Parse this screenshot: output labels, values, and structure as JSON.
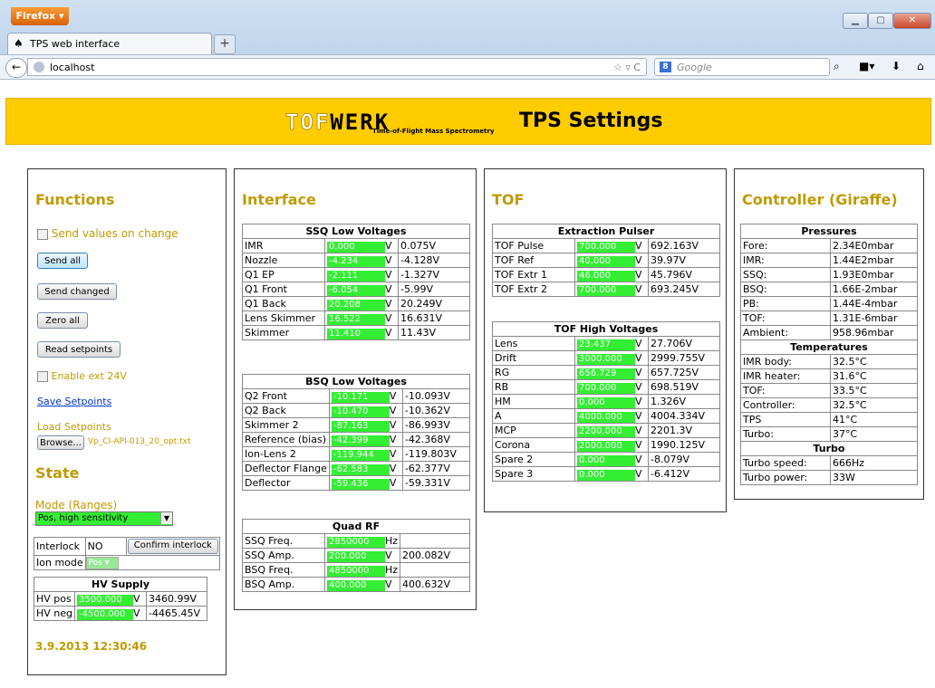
{
  "browser": {
    "app_button": "Firefox",
    "tab_title": "TPS web interface",
    "url": "localhost",
    "search_placeholder": "Google",
    "search_engine_badge": "8"
  },
  "banner": {
    "logo_light": "TOF",
    "logo_dark": "WERK",
    "logo_sub": "Time-of-Flight Mass Spectrometry",
    "title": "TPS Settings"
  },
  "functions": {
    "heading": "Functions",
    "send_on_change": "Send values on change",
    "send_all": "Send all",
    "send_changed": "Send changed",
    "zero_all": "Zero all",
    "read_setpoints": "Read setpoints",
    "enable_24v": "Enable ext 24V",
    "save_setpoints": "Save Setpoints",
    "load_setpoints": "Load Setpoints",
    "browse": "Browse...",
    "file_name": "Vp_CI-API-013_20_opt.txt"
  },
  "state": {
    "heading": "State",
    "mode_label": "Mode (Ranges)",
    "mode_value": "Pos, high sensitivity",
    "interlock_label": "Interlock",
    "interlock_value": "NO",
    "confirm_interlock": "Confirm interlock",
    "ion_mode_label": "Ion mode",
    "ion_mode_value": "Pos",
    "hv_title": "HV Supply",
    "hv_rows": [
      {
        "label": "HV pos",
        "set": "3500.000",
        "unit": "V",
        "read": "3460.99V"
      },
      {
        "label": "HV neg",
        "set": "-4500.000",
        "unit": "V",
        "read": "-4465.45V"
      }
    ],
    "timestamp": "3.9.2013 12:30:46"
  },
  "interface": {
    "heading": "Interface",
    "ssq": {
      "title": "SSQ Low Voltages",
      "rows": [
        {
          "label": "IMR",
          "set": "0.000",
          "unit": "V",
          "read": "0.075V"
        },
        {
          "label": "Nozzle",
          "set": "-4.234",
          "unit": "V",
          "read": "-4.128V"
        },
        {
          "label": "Q1 EP",
          "set": "-2.111",
          "unit": "V",
          "read": "-1.327V"
        },
        {
          "label": "Q1 Front",
          "set": "-6.054",
          "unit": "V",
          "read": "-5.99V"
        },
        {
          "label": "Q1 Back",
          "set": "20.208",
          "unit": "V",
          "read": "20.249V"
        },
        {
          "label": "Lens Skimmer",
          "set": "16.522",
          "unit": "V",
          "read": "16.631V"
        },
        {
          "label": "Skimmer",
          "set": "11.410",
          "unit": "V",
          "read": "11.43V"
        }
      ]
    },
    "bsq": {
      "title": "BSQ Low Voltages",
      "rows": [
        {
          "label": "Q2 Front",
          "set": "-10.171",
          "unit": "V",
          "read": "-10.093V"
        },
        {
          "label": "Q2 Back",
          "set": "-10.470",
          "unit": "V",
          "read": "-10.362V"
        },
        {
          "label": "Skimmer 2",
          "set": "-87.163",
          "unit": "V",
          "read": "-86.993V"
        },
        {
          "label": "Reference (bias)",
          "set": "-42.399",
          "unit": "V",
          "read": "-42.368V"
        },
        {
          "label": "Ion-Lens 2",
          "set": "-119.944",
          "unit": "V",
          "read": "-119.803V"
        },
        {
          "label": "Deflector Flange",
          "set": "-62.583",
          "unit": "V",
          "read": "-62.377V"
        },
        {
          "label": "Deflector",
          "set": "-59.436",
          "unit": "V",
          "read": "-59.331V"
        }
      ]
    },
    "quad": {
      "title": "Quad RF",
      "rows": [
        {
          "label": "SSQ Freq.",
          "set": "2850000",
          "unit": "Hz",
          "read": ""
        },
        {
          "label": "SSQ Amp.",
          "set": "200.000",
          "unit": "V",
          "read": "200.082V"
        },
        {
          "label": "BSQ Freq.",
          "set": "4850000",
          "unit": "Hz",
          "read": ""
        },
        {
          "label": "BSQ Amp.",
          "set": "400.000",
          "unit": "V",
          "read": "400.632V"
        }
      ]
    }
  },
  "tof": {
    "heading": "TOF",
    "extraction": {
      "title": "Extraction Pulser",
      "rows": [
        {
          "label": "TOF Pulse",
          "set": "700.000",
          "unit": "V",
          "read": "692.163V"
        },
        {
          "label": "TOF Ref",
          "set": "40.000",
          "unit": "V",
          "read": "39.97V"
        },
        {
          "label": "TOF Extr 1",
          "set": "46.000",
          "unit": "V",
          "read": "45.796V"
        },
        {
          "label": "TOF Extr 2",
          "set": "700.000",
          "unit": "V",
          "read": "693.245V"
        }
      ]
    },
    "hv": {
      "title": "TOF High Voltages",
      "rows": [
        {
          "label": "Lens",
          "set": "23.437",
          "unit": "V",
          "read": "27.706V"
        },
        {
          "label": "Drift",
          "set": "3000.000",
          "unit": "V",
          "read": "2999.755V"
        },
        {
          "label": "RG",
          "set": "656.729",
          "unit": "V",
          "read": "657.725V"
        },
        {
          "label": "RB",
          "set": "700.000",
          "unit": "V",
          "read": "698.519V"
        },
        {
          "label": "HM",
          "set": "0.000",
          "unit": "V",
          "read": "1.326V"
        },
        {
          "label": "A",
          "set": "4000.000",
          "unit": "V",
          "read": "4004.334V"
        },
        {
          "label": "MCP",
          "set": "2200.000",
          "unit": "V",
          "read": "2201.3V"
        },
        {
          "label": "Corona",
          "set": "2000.000",
          "unit": "V",
          "read": "1990.125V"
        },
        {
          "label": "Spare 2",
          "set": "0.000",
          "unit": "V",
          "read": "-8.079V"
        },
        {
          "label": "Spare 3",
          "set": "0.000",
          "unit": "V",
          "read": "-6.412V"
        }
      ]
    }
  },
  "controller": {
    "heading": "Controller (Giraffe)",
    "pressures_title": "Pressures",
    "pressures": [
      {
        "label": "Fore:",
        "value": "2.34E0mbar"
      },
      {
        "label": "IMR:",
        "value": "1.44E2mbar"
      },
      {
        "label": "SSQ:",
        "value": "1.93E0mbar"
      },
      {
        "label": "BSQ:",
        "value": "1.66E-2mbar"
      },
      {
        "label": "PB:",
        "value": "1.44E-4mbar"
      },
      {
        "label": "TOF:",
        "value": "1.31E-6mbar"
      },
      {
        "label": "Ambient:",
        "value": "958.96mbar"
      }
    ],
    "temps_title": "Temperatures",
    "temps": [
      {
        "label": "IMR body:",
        "value": "32.5°C"
      },
      {
        "label": "IMR heater:",
        "value": "31.6°C"
      },
      {
        "label": "TOF:",
        "value": "33.5°C"
      },
      {
        "label": "Controller:",
        "value": "32.5°C"
      },
      {
        "label": "TPS",
        "value": "41°C"
      },
      {
        "label": "Turbo:",
        "value": "37°C"
      }
    ],
    "turbo_title": "Turbo",
    "turbo": [
      {
        "label": "Turbo speed:",
        "value": "666Hz"
      },
      {
        "label": "Turbo power:",
        "value": "33W"
      }
    ]
  }
}
